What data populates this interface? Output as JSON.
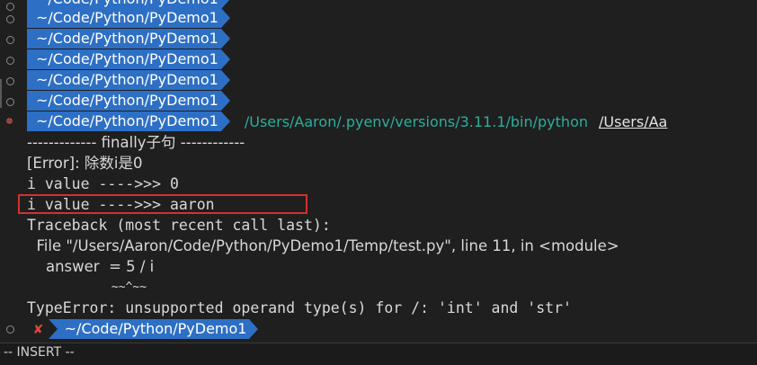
{
  "prompt": {
    "path": "~/Code/Python/PyDemo1"
  },
  "command": {
    "interpreter": "/Users/Aaron/.pyenv/versions/3.11.1/bin/python",
    "argument": "/Users/Aa"
  },
  "output": {
    "finally_header": "------------- finally子句 ------------",
    "error_line": "[Error]: 除数i是0",
    "i_value_zero": "i value ---->>> 0",
    "i_value_aaron": "i value ---->>> aaron",
    "traceback_header": "Traceback (most recent call last):",
    "file_line": "  File \"/Users/Aaron/Code/Python/PyDemo1/Temp/test.py\", line 11, in <module>",
    "code_line": "    answer  = 5 / i",
    "caret_line": "            ~~^~~",
    "type_error": "TypeError: unsupported operand type(s) for /: 'int' and 'str'"
  },
  "final_prompt": {
    "status_mark": "✘",
    "path": "~/Code/Python/PyDemo1"
  },
  "status_bar": {
    "mode": "-- INSERT --"
  },
  "colors": {
    "prompt_bg": "#2d6fc4",
    "command_color": "#2cae9c",
    "highlight_border": "#d2312f",
    "error_mark": "#e05a4f"
  }
}
